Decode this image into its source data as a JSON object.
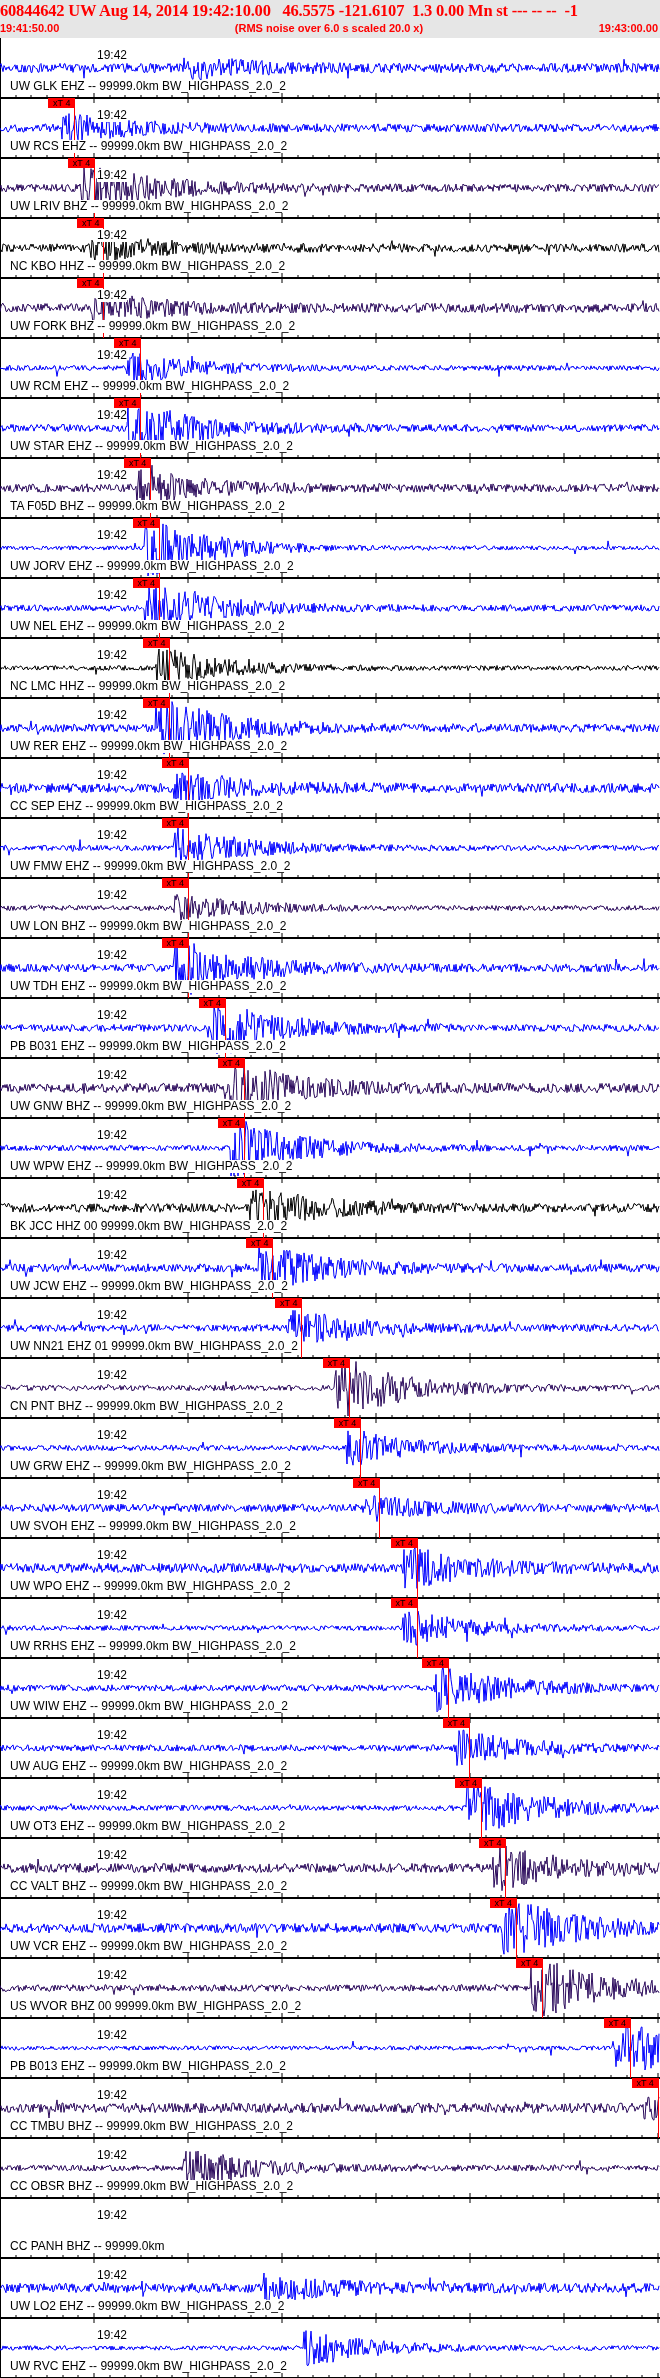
{
  "header": {
    "event_line": "60844642 UW Aug 14, 2014 19:42:10.00   46.5575 -121.6107  1.3 0.00 Mn st --- -- --  -1",
    "start_time": "19:41:50.00",
    "note": "(RMS noise over 6.0 s scaled 20.0 x)",
    "end_time": "19:43:00.00"
  },
  "traces": [
    {
      "kind": "waveform",
      "label": "UW GLK EHZ -- 99999.0km BW_HIGHPASS_2.0_2",
      "time_label": "19:42",
      "color": "#0000ff"
    },
    {
      "kind": "waveform",
      "label": "UW RCS EHZ -- 99999.0km BW_HIGHPASS_2.0_2",
      "time_label": "19:42",
      "color": "#0000ff",
      "pick": {
        "label": "xT 4",
        "level": 0.114
      }
    },
    {
      "kind": "waveform",
      "label": "UW LRIV BHZ -- 99999.0km BW_HIGHPASS_2.0_2",
      "time_label": "19:42",
      "color": "#2b0a5c",
      "pick": {
        "label": "xT 4",
        "level": 0.144
      }
    },
    {
      "kind": "waveform",
      "label": "NC KBO HHZ -- 99999.0km BW_HIGHPASS_2.0_2",
      "time_label": "19:42",
      "color": "#000000",
      "pick": {
        "label": "xT 4",
        "level": 0.158
      }
    },
    {
      "kind": "waveform",
      "label": "UW FORK BHZ -- 99999.0km BW_HIGHPASS_2.0_2",
      "time_label": "19:42",
      "color": "#2b0a5c",
      "pick": {
        "label": "xT 4",
        "level": 0.158
      }
    },
    {
      "kind": "waveform",
      "label": "UW RCM EHZ -- 99999.0km BW_HIGHPASS_2.0_2",
      "time_label": "19:42",
      "color": "#0000ff",
      "pick": {
        "label": "xT 4",
        "level": 0.214
      }
    },
    {
      "kind": "waveform",
      "label": "UW STAR EHZ -- 99999.0km BW_HIGHPASS_2.0_2",
      "time_label": "19:42",
      "color": "#0000ff",
      "pick": {
        "label": "xT 4",
        "level": 0.214
      }
    },
    {
      "kind": "waveform",
      "label": "TA F05D BHZ -- 99999.0km BW_HIGHPASS_2.0_2",
      "time_label": "19:42",
      "color": "#2b0a5c",
      "pick": {
        "label": "xT 4",
        "level": 0.229
      }
    },
    {
      "kind": "waveform",
      "label": "UW JORV EHZ -- 99999.0km BW_HIGHPASS_2.0_2",
      "time_label": "19:42",
      "color": "#0000ff",
      "pick": {
        "label": "xT 4",
        "level": 0.242
      }
    },
    {
      "kind": "waveform",
      "label": "UW NEL EHZ -- 99999.0km BW_HIGHPASS_2.0_2",
      "time_label": "19:42",
      "color": "#0000ff",
      "pick": {
        "label": "xT 4",
        "level": 0.242
      }
    },
    {
      "kind": "waveform",
      "label": "NC LMC HHZ -- 99999.0km BW_HIGHPASS_2.0_2",
      "time_label": "19:42",
      "color": "#000000",
      "pick": {
        "label": "xT 4",
        "level": 0.258
      }
    },
    {
      "kind": "waveform",
      "label": "UW RER EHZ -- 99999.0km BW_HIGHPASS_2.0_2",
      "time_label": "19:42",
      "color": "#0000ff",
      "pick": {
        "label": "xT 4",
        "level": 0.258
      }
    },
    {
      "kind": "waveform",
      "label": "CC SEP EHZ -- 99999.0km BW_HIGHPASS_2.0_2",
      "time_label": "19:42",
      "color": "#0000ff",
      "pick": {
        "label": "xT 4",
        "level": 0.286
      }
    },
    {
      "kind": "waveform",
      "label": "UW FMW EHZ -- 99999.0km BW_HIGHPASS_2.0_2",
      "time_label": "19:42",
      "color": "#0000ff",
      "pick": {
        "label": "xT 4",
        "level": 0.286
      }
    },
    {
      "kind": "waveform",
      "label": "UW LON BHZ -- 99999.0km BW_HIGHPASS_2.0_2",
      "time_label": "19:42",
      "color": "#2b0a5c",
      "pick": {
        "label": "xT 4",
        "level": 0.286
      }
    },
    {
      "kind": "waveform",
      "label": "UW TDH EHZ -- 99999.0km BW_HIGHPASS_2.0_2",
      "time_label": "19:42",
      "color": "#0000ff",
      "pick": {
        "label": "xT 4",
        "level": 0.286
      }
    },
    {
      "kind": "waveform",
      "label": "PB B031 EHZ -- 99999.0km BW_HIGHPASS_2.0_2",
      "time_label": "19:42",
      "color": "#0000ff",
      "pick": {
        "label": "xT 4",
        "level": 0.342
      }
    },
    {
      "kind": "waveform",
      "label": "UW GNW BHZ -- 99999.0km BW_HIGHPASS_2.0_2",
      "time_label": "19:42",
      "color": "#2b0a5c",
      "pick": {
        "label": "xT 4",
        "level": 0.371
      }
    },
    {
      "kind": "waveform",
      "label": "UW WPW EHZ -- 99999.0km BW_HIGHPASS_2.0_2",
      "time_label": "19:42",
      "color": "#0000ff",
      "pick": {
        "label": "xT 4",
        "level": 0.371
      }
    },
    {
      "kind": "waveform",
      "label": "BK JCC HHZ 00 99999.0km BW_HIGHPASS_2.0_2",
      "time_label": "19:42",
      "color": "#000000",
      "pick": {
        "label": "xT 4",
        "level": 0.4
      }
    },
    {
      "kind": "waveform",
      "label": "UW JCW EHZ -- 99999.0km BW_HIGHPASS_2.0_2",
      "time_label": "19:42",
      "color": "#0000ff",
      "pick": {
        "label": "xT 4",
        "level": 0.414
      }
    },
    {
      "kind": "waveform",
      "label": "UW NN21 EHZ 01 99999.0km BW_HIGHPASS_2.0_2",
      "time_label": "19:42",
      "color": "#0000ff",
      "pick": {
        "label": "xT 4",
        "level": 0.458
      }
    },
    {
      "kind": "waveform",
      "label": "CN PNT BHZ -- 99999.0km BW_HIGHPASS_2.0_2",
      "time_label": "19:42",
      "color": "#2b0a5c",
      "pick": {
        "label": "xT 4",
        "level": 0.53
      }
    },
    {
      "kind": "waveform",
      "label": "UW GRW EHZ -- 99999.0km BW_HIGHPASS_2.0_2",
      "time_label": "19:42",
      "color": "#0000ff",
      "pick": {
        "label": "xT 4",
        "level": 0.547
      }
    },
    {
      "kind": "waveform",
      "label": "UW SVOH EHZ -- 99999.0km BW_HIGHPASS_2.0_2",
      "time_label": "19:42",
      "color": "#0000ff",
      "pick": {
        "label": "xT 4",
        "level": 0.576
      }
    },
    {
      "kind": "waveform",
      "label": "UW WPO EHZ -- 99999.0km BW_HIGHPASS_2.0_2",
      "time_label": "19:42",
      "color": "#0000ff",
      "pick": {
        "label": "xT 4",
        "level": 0.633
      }
    },
    {
      "kind": "waveform",
      "label": "UW RRHS EHZ -- 99999.0km BW_HIGHPASS_2.0_2",
      "time_label": "19:42",
      "color": "#0000ff",
      "pick": {
        "label": "xT 4",
        "level": 0.633
      }
    },
    {
      "kind": "waveform",
      "label": "UW WIW EHZ -- 99999.0km BW_HIGHPASS_2.0_2",
      "time_label": "19:42",
      "color": "#0000ff",
      "pick": {
        "label": "xT 4",
        "level": 0.68
      }
    },
    {
      "kind": "waveform",
      "label": "UW AUG EHZ -- 99999.0km BW_HIGHPASS_2.0_2",
      "time_label": "19:42",
      "color": "#0000ff",
      "pick": {
        "label": "xT 4",
        "level": 0.712
      }
    },
    {
      "kind": "waveform",
      "label": "UW OT3 EHZ -- 99999.0km BW_HIGHPASS_2.0_2",
      "time_label": "19:42",
      "color": "#0000ff",
      "pick": {
        "label": "xT 4",
        "level": 0.73
      }
    },
    {
      "kind": "waveform",
      "label": "CC VALT BHZ -- 99999.0km BW_HIGHPASS_2.0_2",
      "time_label": "19:42",
      "color": "#2b0a5c",
      "pick": {
        "label": "xT 4",
        "level": 0.767
      }
    },
    {
      "kind": "waveform",
      "label": "UW VCR EHZ -- 99999.0km BW_HIGHPASS_2.0_2",
      "time_label": "19:42",
      "color": "#0000ff",
      "pick": {
        "label": "xT 4",
        "level": 0.783
      }
    },
    {
      "kind": "waveform",
      "label": "US WVOR BHZ 00 99999.0km BW_HIGHPASS_2.0_2",
      "time_label": "19:42",
      "color": "#2b0a5c",
      "pick": {
        "label": "xT 4",
        "level": 0.823
      }
    },
    {
      "kind": "waveform",
      "label": "PB B013 EHZ -- 99999.0km BW_HIGHPASS_2.0_2",
      "time_label": "19:42",
      "color": "#0000ff",
      "pick": {
        "label": "xT 4",
        "level": 0.956
      }
    },
    {
      "kind": "waveform",
      "label": "CC TMBU BHZ -- 99999.0km BW_HIGHPASS_2.0_2",
      "time_label": "19:42",
      "color": "#2b0a5c",
      "pick": {
        "label": "xT 4",
        "level": 0.998
      }
    },
    {
      "kind": "waveform",
      "label": "CC OBSR BHZ -- 99999.0km BW_HIGHPASS_2.0_2",
      "time_label": "19:42",
      "color": "#2b0a5c"
    },
    {
      "kind": "empty",
      "label": "CC PANH BHZ -- 99999.0km",
      "time_label": "19:42"
    },
    {
      "kind": "waveform",
      "label": "UW LO2 EHZ -- 99999.0km BW_HIGHPASS_2.0_2",
      "time_label": "19:42",
      "color": "#0000ff"
    },
    {
      "kind": "waveform",
      "label": "UW RVC EHZ -- 99999.0km BW_HIGHPASS_2.0_2",
      "time_label": "19:42",
      "color": "#0000ff"
    }
  ]
}
